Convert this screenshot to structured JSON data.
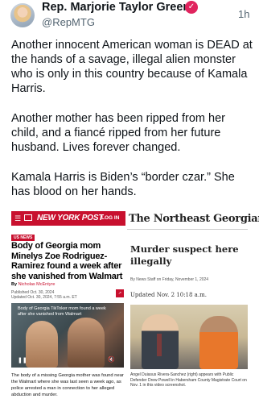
{
  "post": {
    "display_name": "Rep. Marjorie Taylor Greene",
    "verified_icon": "verified-badge-icon",
    "handle": "@RepMTG",
    "time_ago": "1h",
    "paragraphs": [
      "Another innocent American woman is DEAD at the hands of a savage, illegal alien monster who is only in this country because of Kamala Harris.",
      "Another mother has been ripped from her child, and a fiancé ripped from her future husband. Lives forever changed.",
      "Kamala Harris is Biden’s “border czar.” She has blood on her hands."
    ]
  },
  "nyp": {
    "logo": "NEW YORK POST",
    "login": "LOG IN",
    "tag": "US NEWS",
    "headline": "Body of Georgia mom Minelys Zoe Rodriguez-Ramirez found a week after she vanished from Walmart",
    "byline_prefix": "By ",
    "byline_author": "Nicholas McEntyre",
    "published": "Published Oct. 30, 2024",
    "updated": "Updated Oct. 30, 2024, 7:55 a.m. ET",
    "video_caption": "Body of Georgia TikToker mom found a week after she vanished from Walmart",
    "snippet": "The body of a missing Georgia mother was found near the Walmart where she was last seen a week ago, as police arrested a man in connection to her alleged abduction and murder."
  },
  "northeast_georgian": {
    "masthead": "The Northeast Georgian",
    "headline": "Murder suspect here illegally",
    "byline": "By News Staff on Friday, November 1, 2024",
    "updated": "Updated Nov. 2 10:18 a.m.",
    "caption": "Angel Duiasus Rivera-Sanchez (right) appears with Public Defender Drew Powell in Habersham County Magistrate Court on Nov. 1 in this video screenshot."
  }
}
